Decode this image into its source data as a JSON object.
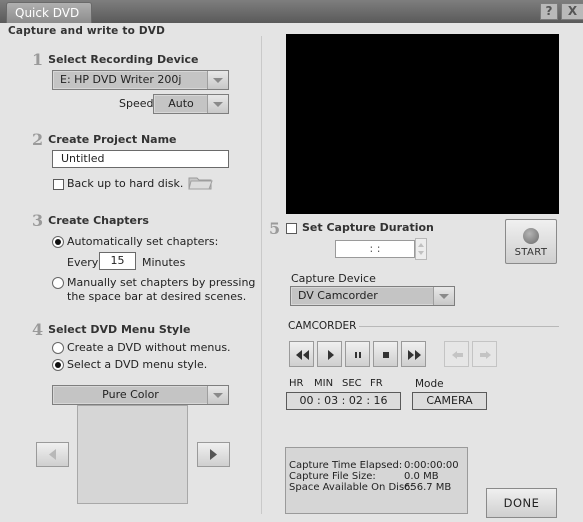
{
  "window": {
    "title": "Quick DVD",
    "subtitle": "Capture and write to DVD",
    "help_label": "?",
    "close_label": "X"
  },
  "step1": {
    "number": "1",
    "title": "Select Recording Device",
    "device_value": "E: HP DVD Writer 200j",
    "speed_label": "Speed",
    "speed_value": "Auto"
  },
  "step2": {
    "number": "2",
    "title": "Create Project Name",
    "project_name": "Untitled",
    "backup_label": "Back up to hard disk.",
    "backup_checked": false
  },
  "step3": {
    "number": "3",
    "title": "Create Chapters",
    "auto_label": "Automatically set chapters:",
    "every_label": "Every",
    "minutes_value": "15",
    "minutes_label": "Minutes",
    "manual_line1": "Manually set chapters by pressing",
    "manual_line2": "the space bar at desired scenes.",
    "selected": "auto"
  },
  "step4": {
    "number": "4",
    "title": "Select DVD Menu Style",
    "no_menu_label": "Create a DVD without menus.",
    "menu_label": "Select a DVD menu style.",
    "selected": "menu",
    "menu_style_value": "Pure Color"
  },
  "step5": {
    "number": "5",
    "title": "Set Capture Duration",
    "duration_checked": false,
    "duration_value": ":   :",
    "start_label": "START",
    "capture_device_label": "Capture Device",
    "capture_device_value": "DV Camcorder"
  },
  "camcorder": {
    "section_label": "CAMCORDER",
    "timecode_headers": [
      "HR",
      "MIN",
      "SEC",
      "FR"
    ],
    "timecode_value": "00 : 03 : 02 : 16",
    "mode_label": "Mode",
    "mode_value": "CAMERA"
  },
  "status": {
    "rows": [
      {
        "label": "Capture Time Elapsed:",
        "value": "0:00:00:00"
      },
      {
        "label": "Capture File Size:",
        "value": "0.0 MB"
      },
      {
        "label": "Space Available On Disc:",
        "value": "656.7 MB"
      }
    ]
  },
  "done_label": "DONE"
}
